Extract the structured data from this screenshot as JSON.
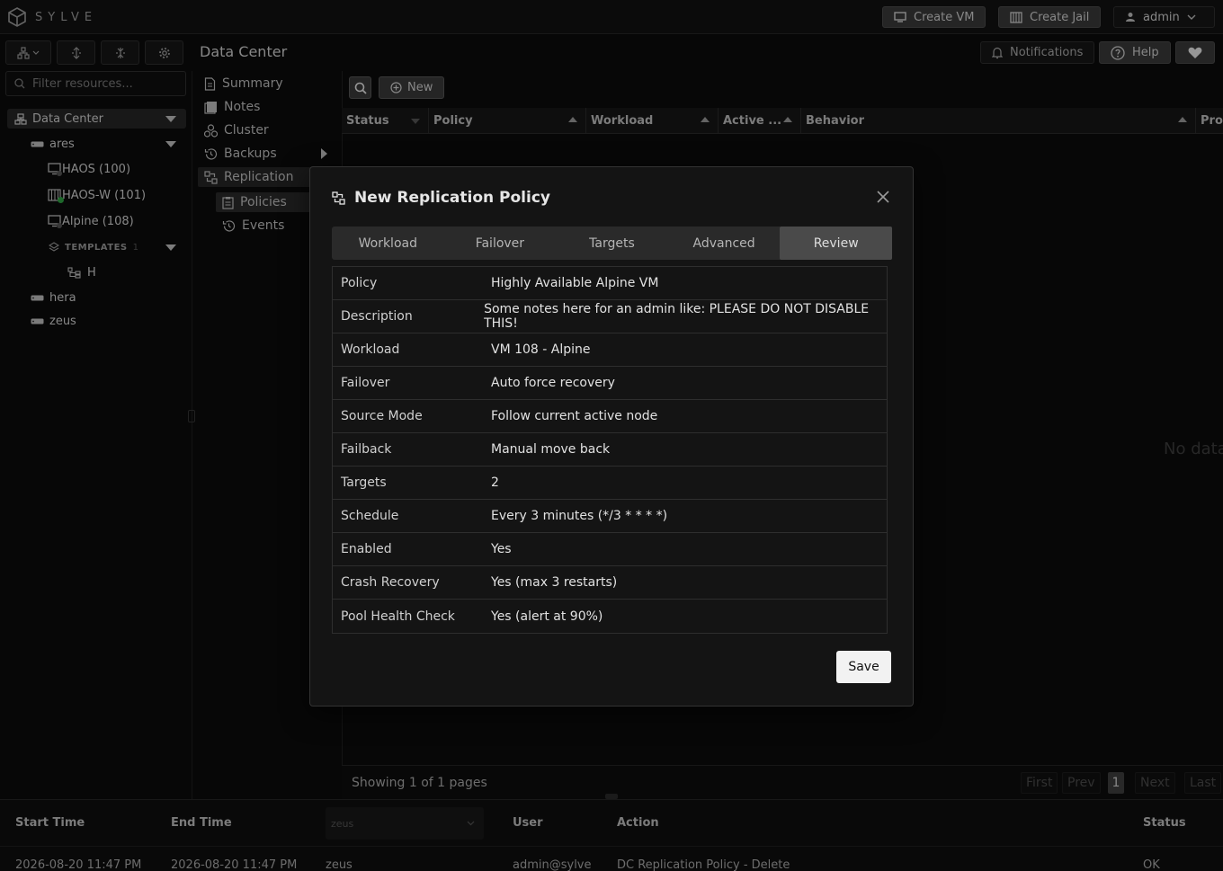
{
  "app": {
    "name": "SYLVE"
  },
  "topbar": {
    "create_vm": "Create VM",
    "create_jail": "Create Jail",
    "user": "admin"
  },
  "header": {
    "title": "Data Center",
    "notifications": "Notifications",
    "help": "Help"
  },
  "filter": {
    "placeholder": "Filter resources..."
  },
  "tree": {
    "root": "Data Center",
    "node_ares": "ares",
    "vm1": "HAOS (100)",
    "vm2": "HAOS-W (101)",
    "vm3": "Alpine (108)",
    "templates": "TEMPLATES",
    "templates_count": "1",
    "template_item": "H",
    "node_hera": "hera",
    "node_zeus": "zeus"
  },
  "nav": {
    "summary": "Summary",
    "notes": "Notes",
    "cluster": "Cluster",
    "backups": "Backups",
    "replication": "Replication",
    "policies": "Policies",
    "events": "Events"
  },
  "table": {
    "new_label": "New",
    "columns": [
      "Status",
      "Policy",
      "Workload",
      "Active ...",
      "Behavior",
      "Pro"
    ],
    "empty": "No data",
    "pager_text": "Showing 1 of 1 pages",
    "first": "First",
    "prev": "Prev",
    "page": "1",
    "next": "Next",
    "last": "Last"
  },
  "modal": {
    "title": "New Replication Policy",
    "tabs": [
      "Workload",
      "Failover",
      "Targets",
      "Advanced",
      "Review"
    ],
    "active_tab": "Review",
    "rows": [
      {
        "key": "Policy",
        "value": "Highly Available Alpine VM"
      },
      {
        "key": "Description",
        "value": "Some notes here for an admin like: PLEASE DO NOT DISABLE THIS!"
      },
      {
        "key": "Workload",
        "value": "VM 108 - Alpine"
      },
      {
        "key": "Failover",
        "value": "Auto force recovery"
      },
      {
        "key": "Source Mode",
        "value": "Follow current active node"
      },
      {
        "key": "Failback",
        "value": "Manual move back"
      },
      {
        "key": "Targets",
        "value": "2"
      },
      {
        "key": "Schedule",
        "value": "Every 3 minutes (*/3 * * * *)"
      },
      {
        "key": "Enabled",
        "value": "Yes"
      },
      {
        "key": "Crash Recovery",
        "value": "Yes (max 3 restarts)"
      },
      {
        "key": "Pool Health Check",
        "value": "Yes (alert at 90%)"
      }
    ],
    "save": "Save"
  },
  "tasks": {
    "headers": {
      "start": "Start Time",
      "end": "End Time",
      "user": "User",
      "action": "Action",
      "status": "Status"
    },
    "node_select": "zeus",
    "row": {
      "start": "2026-08-20 11:47 PM",
      "end": "2026-08-20 11:47 PM",
      "node": "zeus",
      "user": "admin@sylve",
      "action": "DC Replication Policy - Delete",
      "status": "OK"
    }
  },
  "colors": {
    "accent_dot": "#2ea043",
    "bg": "#0b0b0b",
    "panel": "#141414"
  }
}
